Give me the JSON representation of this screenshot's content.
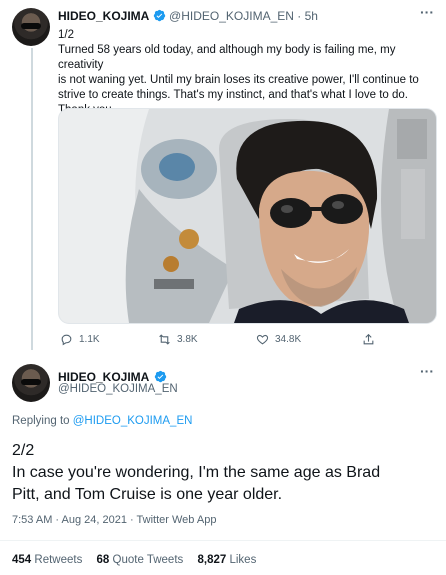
{
  "tweet1": {
    "display_name": "HIDEO_KOJIMA",
    "handle": "@HIDEO_KOJIMA_EN",
    "separator": "·",
    "time": "5h",
    "thread_index": "1/2",
    "text_lines": [
      "Turned 58 years old today, and although my body is failing me, my creativity",
      "is not waning yet. Until my brain loses its creative power, I'll continue to",
      "strive to create things. That's my instinct, and that's what I love to do.",
      "Thank you."
    ],
    "replies": "1.1K",
    "retweets": "3.8K",
    "likes": "34.8K"
  },
  "tweet2": {
    "display_name": "HIDEO_KOJIMA",
    "handle": "@HIDEO_KOJIMA_EN",
    "replying_prefix": "Replying to",
    "replying_to": "@HIDEO_KOJIMA_EN",
    "thread_index": "2/2",
    "text_lines": [
      "In case you're wondering, I'm the same age as Brad",
      "Pitt, and Tom Cruise is one year older."
    ],
    "timestamp": "7:53 AM · Aug 24, 2021 · Twitter Web App",
    "stats": {
      "retweets_count": "454",
      "retweets_label": "Retweets",
      "quotes_count": "68",
      "quotes_label": "Quote Tweets",
      "likes_count": "8,827",
      "likes_label": "Likes"
    }
  },
  "colors": {
    "accent": "#1d9bf0",
    "text": "#0f1419",
    "muted": "#536471",
    "divider": "#eff3f4"
  },
  "icons": [
    "verified-badge-icon",
    "more-icon",
    "reply-icon",
    "retweet-icon",
    "like-icon",
    "share-icon"
  ]
}
